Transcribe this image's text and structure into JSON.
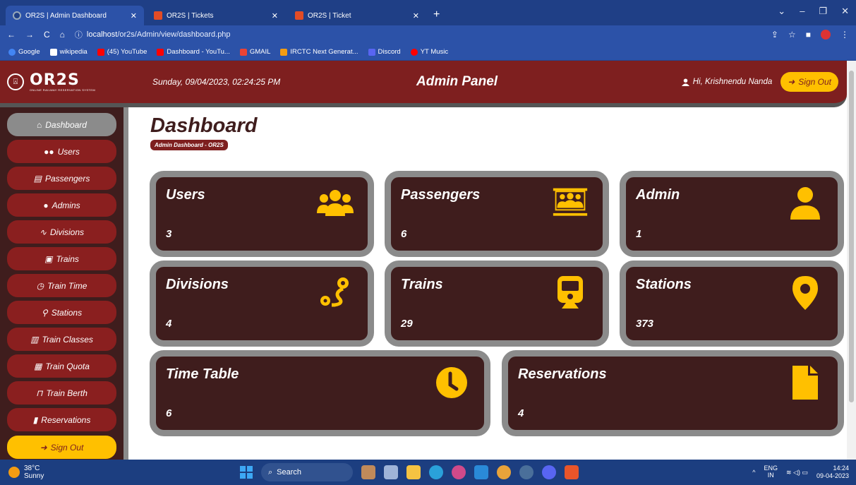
{
  "browser": {
    "tabs": [
      {
        "title": "OR2S | Admin Dashboard",
        "active": true
      },
      {
        "title": "OR2S | Tickets",
        "active": false
      },
      {
        "title": "OR2S | Ticket",
        "active": false
      }
    ],
    "url_host": "localhost",
    "url_path": "/or2s/Admin/view/dashboard.php",
    "bookmarks": [
      {
        "label": "Google",
        "color": "#4285f4"
      },
      {
        "label": "wikipedia",
        "color": "#ffffff"
      },
      {
        "label": "(45) YouTube",
        "color": "#ff0000"
      },
      {
        "label": "Dashboard - YouTu...",
        "color": "#ff0000"
      },
      {
        "label": "GMAIL",
        "color": "#ea4335"
      },
      {
        "label": "IRCTC Next Generat...",
        "color": "#f39c12"
      },
      {
        "label": "Discord",
        "color": "#5865f2"
      },
      {
        "label": "YT Music",
        "color": "#ff0000"
      }
    ]
  },
  "header": {
    "logo_text": "OR2S",
    "logo_sub": "ONLINE RAILWAY RESERVATION SYSTEM",
    "datetime": "Sunday, 09/04/2023, 02:24:25 PM",
    "panel_title": "Admin Panel",
    "greeting": "Hi, Krishnendu Nanda",
    "signout": "Sign Out"
  },
  "sidebar": {
    "items": [
      {
        "label": "Dashboard",
        "icon": "home-icon"
      },
      {
        "label": "Users",
        "icon": "users-icon"
      },
      {
        "label": "Passengers",
        "icon": "passengers-icon"
      },
      {
        "label": "Admins",
        "icon": "user-icon"
      },
      {
        "label": "Divisions",
        "icon": "route-icon"
      },
      {
        "label": "Trains",
        "icon": "train-icon"
      },
      {
        "label": "Train Time",
        "icon": "clock-icon"
      },
      {
        "label": "Stations",
        "icon": "location-icon"
      },
      {
        "label": "Train Classes",
        "icon": "class-icon"
      },
      {
        "label": "Train Quota",
        "icon": "table-icon"
      },
      {
        "label": "Train Berth",
        "icon": "berth-icon"
      },
      {
        "label": "Reservations",
        "icon": "file-icon"
      }
    ],
    "signout": "Sign Out"
  },
  "main": {
    "title": "Dashboard",
    "breadcrumb": "Admin Dashboard - OR2S",
    "cards": [
      {
        "title": "Users",
        "value": "3",
        "icon": "users-icon"
      },
      {
        "title": "Passengers",
        "value": "6",
        "icon": "passengers-icon"
      },
      {
        "title": "Admin",
        "value": "1",
        "icon": "user-icon"
      },
      {
        "title": "Divisions",
        "value": "4",
        "icon": "route-icon"
      },
      {
        "title": "Trains",
        "value": "29",
        "icon": "train-icon"
      },
      {
        "title": "Stations",
        "value": "373",
        "icon": "location-icon"
      },
      {
        "title": "Time Table",
        "value": "6",
        "icon": "clock-icon"
      },
      {
        "title": "Reservations",
        "value": "4",
        "icon": "file-icon"
      }
    ]
  },
  "taskbar": {
    "temp": "38°C",
    "weather": "Sunny",
    "search": "Search",
    "lang": "ENG",
    "region": "IN",
    "time": "14:24",
    "date": "09-04-2023"
  },
  "colors": {
    "maroon": "#7e1f1f",
    "dark_card": "#3f1d1d",
    "accent": "#ffc000",
    "border_gray": "#8b8b8b"
  }
}
